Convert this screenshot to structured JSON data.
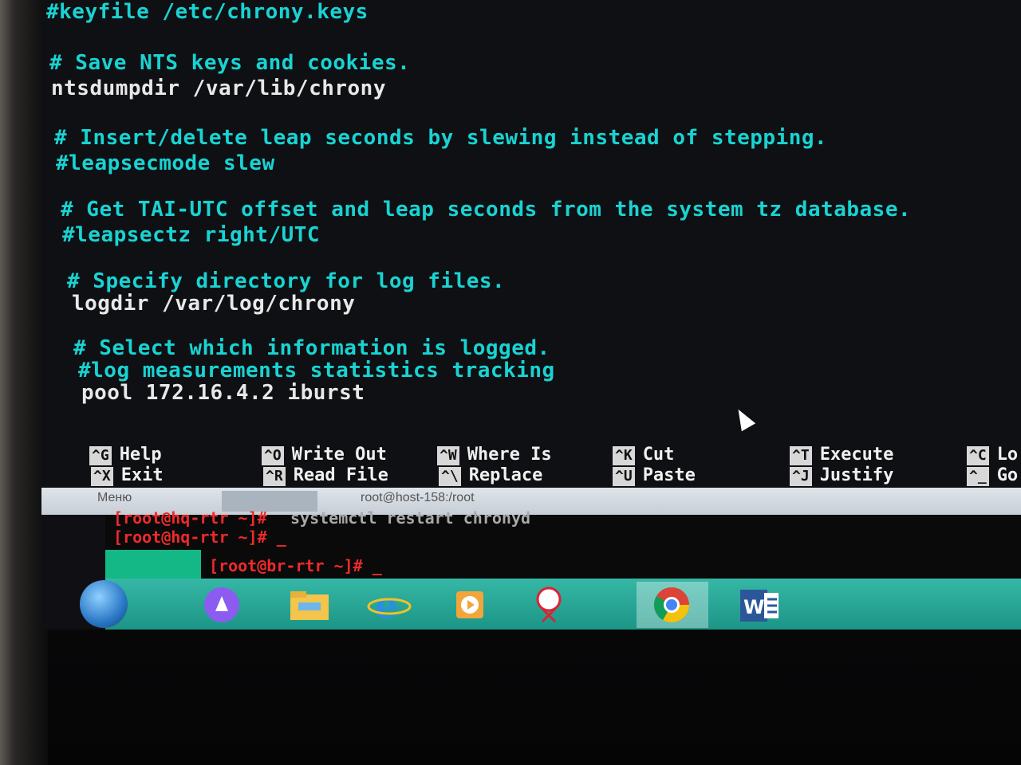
{
  "nano": {
    "lines": [
      {
        "text": "#keyfile /etc/chrony.keys",
        "kind": "cmt"
      },
      {
        "text": "# Save NTS keys and cookies.",
        "kind": "cmt"
      },
      {
        "text": "ntsdumpdir /var/lib/chrony",
        "kind": "cfg"
      },
      {
        "text": "# Insert/delete leap seconds by slewing instead of stepping.",
        "kind": "cmt"
      },
      {
        "text": "#leapsecmode slew",
        "kind": "cmt"
      },
      {
        "text": "# Get TAI-UTC offset and leap seconds from the system tz database.",
        "kind": "cmt"
      },
      {
        "text": "#leapsectz right/UTC",
        "kind": "cmt"
      },
      {
        "text": "# Specify directory for log files.",
        "kind": "cmt"
      },
      {
        "text": "logdir /var/log/chrony",
        "kind": "cfg"
      },
      {
        "text": "# Select which information is logged.",
        "kind": "cmt"
      },
      {
        "text": "#log measurements statistics tracking",
        "kind": "cmt"
      },
      {
        "text": "pool 172.16.4.2 iburst",
        "kind": "cfg"
      }
    ],
    "shortcuts": [
      {
        "key": "^G",
        "label": "Help"
      },
      {
        "key": "^X",
        "label": "Exit"
      },
      {
        "key": "^O",
        "label": "Write Out"
      },
      {
        "key": "^R",
        "label": "Read File"
      },
      {
        "key": "^W",
        "label": "Where Is"
      },
      {
        "key": "^\\",
        "label": "Replace"
      },
      {
        "key": "^K",
        "label": "Cut"
      },
      {
        "key": "^U",
        "label": "Paste"
      },
      {
        "key": "^T",
        "label": "Execute"
      },
      {
        "key": "^J",
        "label": "Justify"
      },
      {
        "key": "^C",
        "label": "Lo"
      },
      {
        "key": "^_",
        "label": "Go"
      }
    ]
  },
  "windows": {
    "menu_label": "Меню",
    "window_title": "root@host-158:/root"
  },
  "hq_terminal": {
    "prev_line_prompt": "[root@hq-rtr ~]#",
    "prev_line_cmd": "systemctl restart chronyd",
    "prompt": "[root@hq-rtr ~]# _"
  },
  "br_terminal": {
    "prompt": "[root@br-rtr ~]# _"
  },
  "taskbar": {
    "icons": [
      "start-orb-icon",
      "alice-assistant-icon",
      "file-explorer-icon",
      "internet-explorer-icon",
      "media-player-icon",
      "snipping-tool-icon",
      "chrome-icon",
      "word-icon"
    ]
  }
}
